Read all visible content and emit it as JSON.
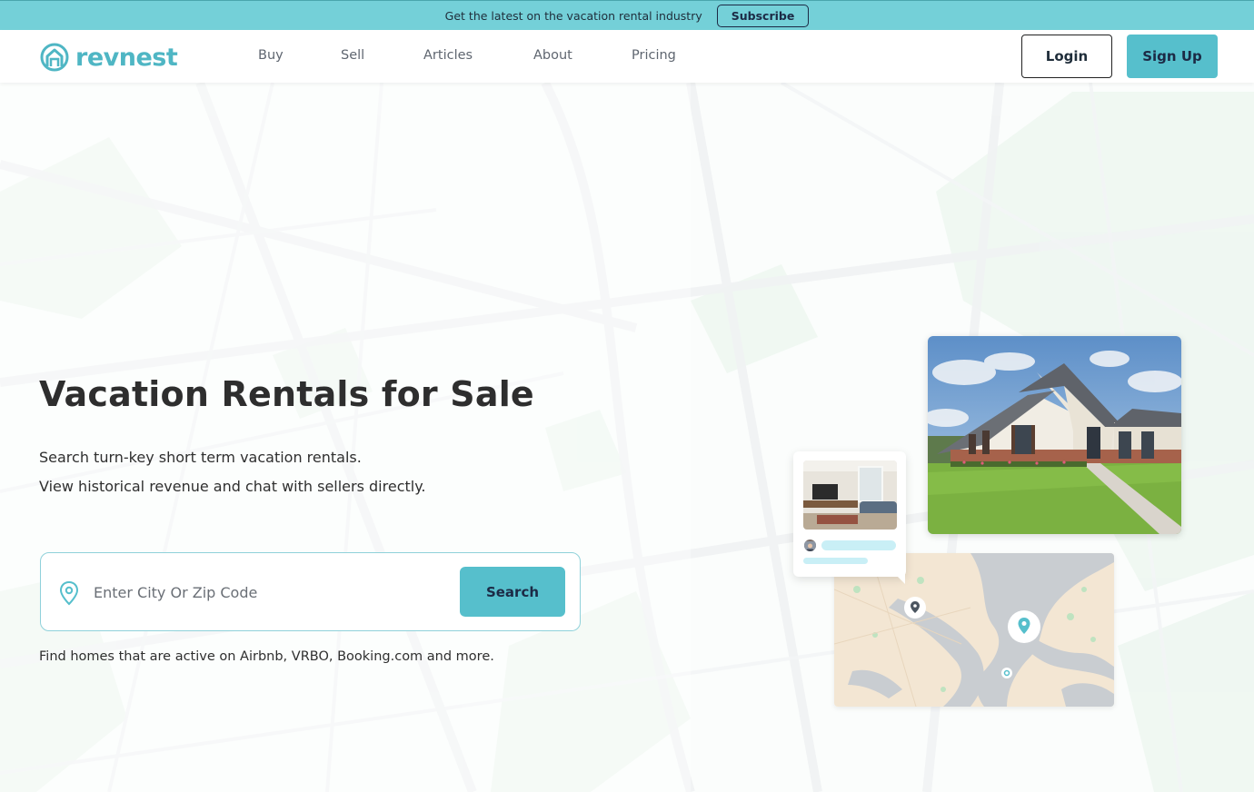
{
  "promo": {
    "text": "Get the latest on the vacation rental industry",
    "button_label": "Subscribe"
  },
  "header": {
    "logo_text": "revnest",
    "nav": [
      {
        "label": "Buy"
      },
      {
        "label": "Sell"
      },
      {
        "label": "Articles"
      },
      {
        "label": "About"
      },
      {
        "label": "Pricing"
      }
    ],
    "login_label": "Login",
    "signup_label": "Sign Up"
  },
  "hero": {
    "title": "Vacation Rentals for Sale",
    "subtitle_line1": "Search turn-key short term vacation rentals.",
    "subtitle_line2": "View historical revenue and chat with sellers directly.",
    "search_placeholder": "Enter City Or Zip Code",
    "search_value": "",
    "search_button_label": "Search",
    "note": "Find homes that are active on Airbnb, VRBO, Booking.com and more."
  },
  "colors": {
    "accent": "#56bfcc",
    "promo_bg": "#74d0d8",
    "logo": "#4fb6c4",
    "dark_text": "#1c2a45"
  },
  "icons": {
    "logo": "house-in-circle-icon",
    "location": "location-pin-icon",
    "map_pin": "map-pin-icon"
  }
}
